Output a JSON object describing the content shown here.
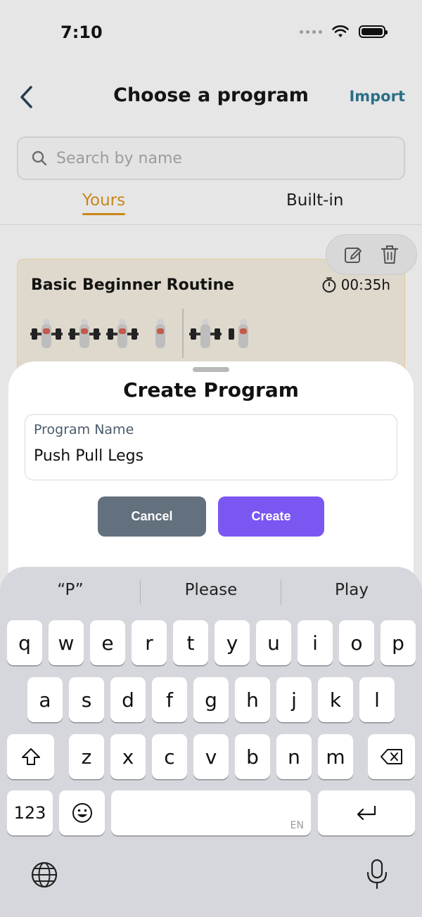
{
  "status_bar": {
    "time": "7:10"
  },
  "header": {
    "title": "Choose a program",
    "import_label": "Import"
  },
  "search": {
    "placeholder": "Search by name"
  },
  "tabs": [
    {
      "label": "Yours"
    },
    {
      "label": "Built-in"
    }
  ],
  "program_card": {
    "title": "Basic Beginner Routine",
    "duration": "00:35h"
  },
  "dialog": {
    "title": "Create Program",
    "field_label": "Program Name",
    "field_value": "Push Pull Legs",
    "cancel_label": "Cancel",
    "create_label": "Create"
  },
  "keyboard": {
    "suggestions": [
      "“P”",
      "Please",
      "Play"
    ],
    "row1": [
      "q",
      "w",
      "e",
      "r",
      "t",
      "y",
      "u",
      "i",
      "o",
      "p"
    ],
    "row2": [
      "a",
      "s",
      "d",
      "f",
      "g",
      "h",
      "j",
      "k",
      "l"
    ],
    "row3": [
      "z",
      "x",
      "c",
      "v",
      "b",
      "n",
      "m"
    ],
    "numbers_label": "123",
    "space_lang": "EN"
  },
  "colors": {
    "accent_tab": "#c9861b",
    "import": "#2b6f86",
    "create_button": "#7b57f2",
    "cancel_button": "#63707e"
  },
  "icons": [
    "back-chevron-icon",
    "wifi-icon",
    "battery-icon",
    "search-icon",
    "edit-icon",
    "trash-icon",
    "timer-icon",
    "shift-icon",
    "backspace-icon",
    "emoji-icon",
    "return-icon",
    "globe-icon",
    "microphone-icon"
  ]
}
